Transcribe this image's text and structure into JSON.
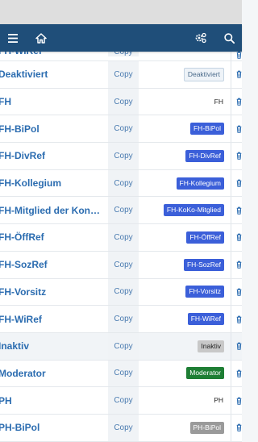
{
  "navbar": {
    "menu_icon": "menu-icon",
    "home_icon": "home-icon",
    "settings_icon": "settings-gear-icon",
    "search_icon": "search-icon",
    "bg_color": "#1f4e79"
  },
  "rows": [
    {
      "name": "FH-WiRef",
      "copy": "Copy",
      "badge": "",
      "badge_style": "none",
      "partial": true
    },
    {
      "name": "Deaktiviert",
      "copy": "Copy",
      "badge": "Deaktiviert",
      "badge_style": "light",
      "badge_bg": "#eef3f8",
      "badge_fg": "#4a6a8a",
      "badge_border": "#c4d3e2"
    },
    {
      "name": "FH",
      "copy": "Copy",
      "badge": "FH",
      "badge_style": "plain"
    },
    {
      "name": "FH-BiPol",
      "copy": "Copy",
      "badge": "FH-BiPol",
      "badge_style": "solid",
      "badge_bg": "#3b5fd9",
      "badge_fg": "#ffffff"
    },
    {
      "name": "FH-DivRef",
      "copy": "Copy",
      "badge": "FH-DivRef",
      "badge_style": "solid",
      "badge_bg": "#3b5fd9",
      "badge_fg": "#ffffff"
    },
    {
      "name": "FH-Kollegium",
      "copy": "Copy",
      "badge": "FH-Kollegium",
      "badge_style": "solid",
      "badge_bg": "#3b5fd9",
      "badge_fg": "#ffffff"
    },
    {
      "name": "FH-Mitglied der Kon…",
      "copy": "Copy",
      "badge": "FH-KoKo-Mitglied",
      "badge_style": "solid",
      "badge_bg": "#3b5fd9",
      "badge_fg": "#ffffff"
    },
    {
      "name": "FH-ÖffRef",
      "copy": "Copy",
      "badge": "FH-ÖffRef",
      "badge_style": "solid",
      "badge_bg": "#3b5fd9",
      "badge_fg": "#ffffff"
    },
    {
      "name": "FH-SozRef",
      "copy": "Copy",
      "badge": "FH-SozRef",
      "badge_style": "solid",
      "badge_bg": "#3b5fd9",
      "badge_fg": "#ffffff"
    },
    {
      "name": "FH-Vorsitz",
      "copy": "Copy",
      "badge": "FH-Vorsitz",
      "badge_style": "solid",
      "badge_bg": "#3b5fd9",
      "badge_fg": "#ffffff"
    },
    {
      "name": "FH-WiRef",
      "copy": "Copy",
      "badge": "FH-WiRef",
      "badge_style": "solid",
      "badge_bg": "#3b5fd9",
      "badge_fg": "#ffffff"
    },
    {
      "name": "Inaktiv",
      "copy": "Copy",
      "badge": "Inaktiv",
      "badge_style": "solid",
      "badge_bg": "#c8c8c8",
      "badge_fg": "#222222",
      "inactive": true
    },
    {
      "name": "Moderator",
      "copy": "Copy",
      "badge": "Moderator",
      "badge_style": "solid",
      "badge_bg": "#1e7e34",
      "badge_fg": "#ffffff"
    },
    {
      "name": "PH",
      "copy": "Copy",
      "badge": "PH",
      "badge_style": "plain"
    },
    {
      "name": "PH-BiPol",
      "copy": "Copy",
      "badge": "PH-BiPol",
      "badge_style": "solid",
      "badge_bg": "#9a9a9a",
      "badge_fg": "#ffffff"
    }
  ],
  "trash_icon": "trash-icon",
  "accent_link_color": "#2b6cb0"
}
